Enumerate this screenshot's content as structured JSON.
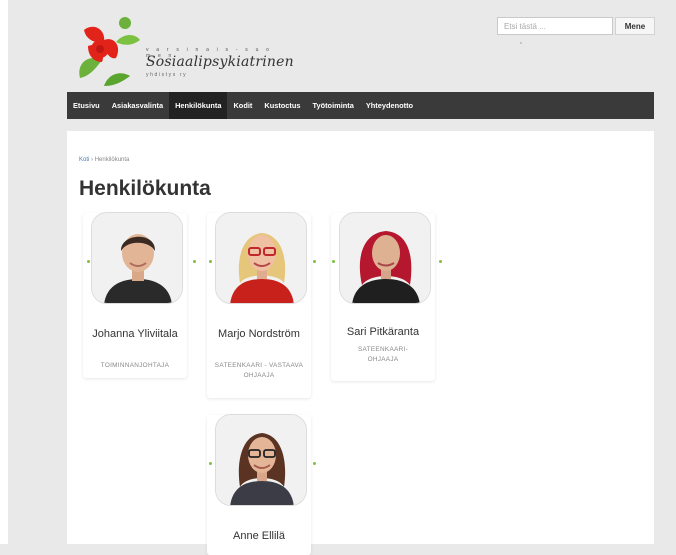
{
  "header": {
    "logo": {
      "tagline_top": "v a r s i n a i s - s u o m e n",
      "name": "Sosiaalipsykiatrinen",
      "tagline_bottom": "yhdistys ry"
    },
    "search": {
      "placeholder": "Etsi tästä ...",
      "button_label": "Mene"
    }
  },
  "nav": {
    "items": [
      {
        "label": "Etusivu"
      },
      {
        "label": "Asiakasvalinta"
      },
      {
        "label": "Henkilökunta",
        "active": true
      },
      {
        "label": "Kodit"
      },
      {
        "label": "Kustoctus"
      },
      {
        "label": "Työtoiminta"
      },
      {
        "label": "Yhteydenotto"
      }
    ]
  },
  "breadcrumb": {
    "home": "Koti",
    "separator": " › ",
    "current": "Henkilökunta"
  },
  "page": {
    "title": "Henkilökunta"
  },
  "staff": [
    {
      "name": "Johanna Yliviitala",
      "role": "TOIMINNANJOHTAJA"
    },
    {
      "name": "Marjo Nordström",
      "role": "SATEENKAARI - VASTAAVA OHJAAJA"
    },
    {
      "name": "Sari Pitkäranta",
      "role": "SATEENKAARI- OHJAAJA"
    },
    {
      "name": "Anne Ellilä",
      "role": ""
    }
  ],
  "colors": {
    "nav_bg": "#3a3a3a",
    "accent_green": "#7cc242",
    "logo_red": "#e2231a",
    "logo_green": "#5aa52e"
  }
}
